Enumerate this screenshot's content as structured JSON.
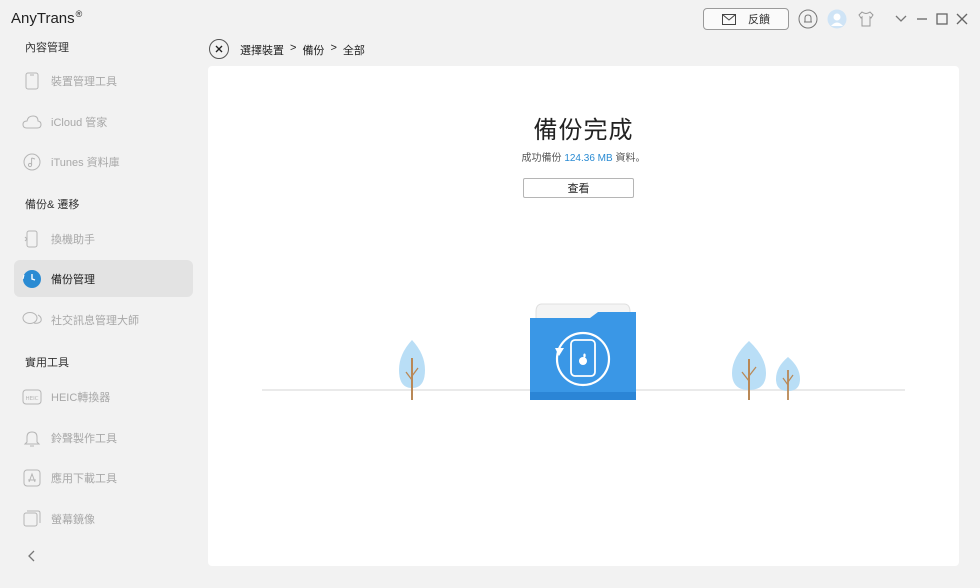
{
  "app": {
    "title": "AnyTrans",
    "reg": "®"
  },
  "toolbar": {
    "feedback_label": "反饋"
  },
  "sidebar": {
    "sections": [
      {
        "title": "內容管理",
        "items": [
          {
            "label": "裝置管理工具",
            "icon": "phone-icon"
          },
          {
            "label": "iCloud 管家",
            "icon": "cloud-icon"
          },
          {
            "label": "iTunes 資料庫",
            "icon": "music-note-icon"
          }
        ]
      },
      {
        "title": "備份& 遷移",
        "items": [
          {
            "label": "換機助手",
            "icon": "phone-transfer-icon"
          },
          {
            "label": "備份管理",
            "icon": "backup-clock-icon",
            "active": true
          },
          {
            "label": "社交訊息管理大師",
            "icon": "chat-bubbles-icon"
          }
        ]
      },
      {
        "title": "實用工具",
        "items": [
          {
            "label": "HEIC轉換器",
            "icon": "heic-icon"
          },
          {
            "label": "鈴聲製作工具",
            "icon": "bell-icon"
          },
          {
            "label": "應用下載工具",
            "icon": "app-store-icon"
          },
          {
            "label": "螢幕鏡像",
            "icon": "screen-mirror-icon"
          }
        ]
      }
    ]
  },
  "breadcrumb": {
    "items": [
      "選擇裝置",
      "備份",
      "全部"
    ],
    "separator": ">"
  },
  "result": {
    "title": "備份完成",
    "message_prefix": "成功備份 ",
    "size": "124.36 MB",
    "message_suffix": " 資料。",
    "view_button": "查看"
  },
  "colors": {
    "accent": "#2a8bd3",
    "folder": "#3a97e6",
    "tree": "#b9def6",
    "active_bg": "#e3e3e3"
  }
}
